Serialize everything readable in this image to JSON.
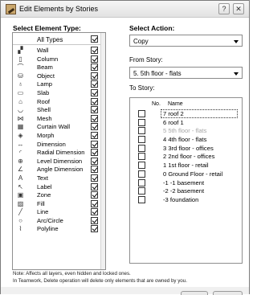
{
  "window": {
    "title": "Edit Elements by Stories",
    "help_glyph": "?",
    "close_glyph": "✕"
  },
  "left": {
    "title": "Select Element Type:",
    "all_types": {
      "label": "All Types",
      "checked": true
    },
    "items": [
      {
        "label": "Wall",
        "icon": "wall-icon",
        "glyph": "▞",
        "checked": true
      },
      {
        "label": "Column",
        "icon": "column-icon",
        "glyph": "▯",
        "checked": true
      },
      {
        "label": "Beam",
        "icon": "beam-icon",
        "glyph": "⌒",
        "checked": true
      },
      {
        "label": "Object",
        "icon": "object-icon",
        "glyph": "⛁",
        "checked": true
      },
      {
        "label": "Lamp",
        "icon": "lamp-icon",
        "glyph": "♁",
        "checked": true
      },
      {
        "label": "Slab",
        "icon": "slab-icon",
        "glyph": "▭",
        "checked": true
      },
      {
        "label": "Roof",
        "icon": "roof-icon",
        "glyph": "⌂",
        "checked": true
      },
      {
        "label": "Shell",
        "icon": "shell-icon",
        "glyph": "◡",
        "checked": true
      },
      {
        "label": "Mesh",
        "icon": "mesh-icon",
        "glyph": "⋈",
        "checked": true
      },
      {
        "label": "Curtain Wall",
        "icon": "curtain-wall-icon",
        "glyph": "▦",
        "checked": true
      },
      {
        "label": "Morph",
        "icon": "morph-icon",
        "glyph": "◈",
        "checked": true
      },
      {
        "label": "Dimension",
        "icon": "dimension-icon",
        "glyph": "↔",
        "checked": true
      },
      {
        "label": "Radial Dimension",
        "icon": "radial-dimension-icon",
        "glyph": "◜",
        "checked": true
      },
      {
        "label": "Level Dimension",
        "icon": "level-dimension-icon",
        "glyph": "⊕",
        "checked": true
      },
      {
        "label": "Angle Dimension",
        "icon": "angle-dimension-icon",
        "glyph": "∠",
        "checked": true
      },
      {
        "label": "Text",
        "icon": "text-icon",
        "glyph": "A",
        "checked": true
      },
      {
        "label": "Label",
        "icon": "label-icon",
        "glyph": "↖",
        "checked": true
      },
      {
        "label": "Zone",
        "icon": "zone-icon",
        "glyph": "▣",
        "checked": true
      },
      {
        "label": "Fill",
        "icon": "fill-icon",
        "glyph": "▨",
        "checked": true
      },
      {
        "label": "Line",
        "icon": "line-icon",
        "glyph": "╱",
        "checked": true
      },
      {
        "label": "Arc/Circle",
        "icon": "arc-circle-icon",
        "glyph": "○",
        "checked": true
      },
      {
        "label": "Polyline",
        "icon": "polyline-icon",
        "glyph": "⌇",
        "checked": true
      }
    ]
  },
  "right": {
    "action_title": "Select Action:",
    "action_value": "Copy",
    "from_label": "From Story:",
    "from_value": "5. 5th floor - flats",
    "to_label": "To Story:",
    "col_no": "No.",
    "col_name": "Name",
    "stories": [
      {
        "name": "7 roof 2",
        "checked": false,
        "dim": false
      },
      {
        "name": "6 roof 1",
        "checked": false,
        "dim": false
      },
      {
        "name": "5 5th floor - flats",
        "checked": false,
        "dim": true
      },
      {
        "name": "4 4th floor - flats",
        "checked": false,
        "dim": false
      },
      {
        "name": "3 3rd floor - offices",
        "checked": false,
        "dim": false
      },
      {
        "name": "2 2nd floor - offices",
        "checked": false,
        "dim": false
      },
      {
        "name": "1 1st floor - retail",
        "checked": false,
        "dim": false
      },
      {
        "name": "0 Ground Floor - retail",
        "checked": false,
        "dim": false
      },
      {
        "name": "-1 -1 basement",
        "checked": false,
        "dim": false
      },
      {
        "name": "-2 -2 basement",
        "checked": false,
        "dim": false
      },
      {
        "name": "-3 foundation",
        "checked": false,
        "dim": false
      }
    ]
  },
  "note": {
    "line1": "Note: Affects all layers, even hidden and locked ones.",
    "line2": "In Teamwork, Delete operation will delete only elements that are owned by you."
  }
}
